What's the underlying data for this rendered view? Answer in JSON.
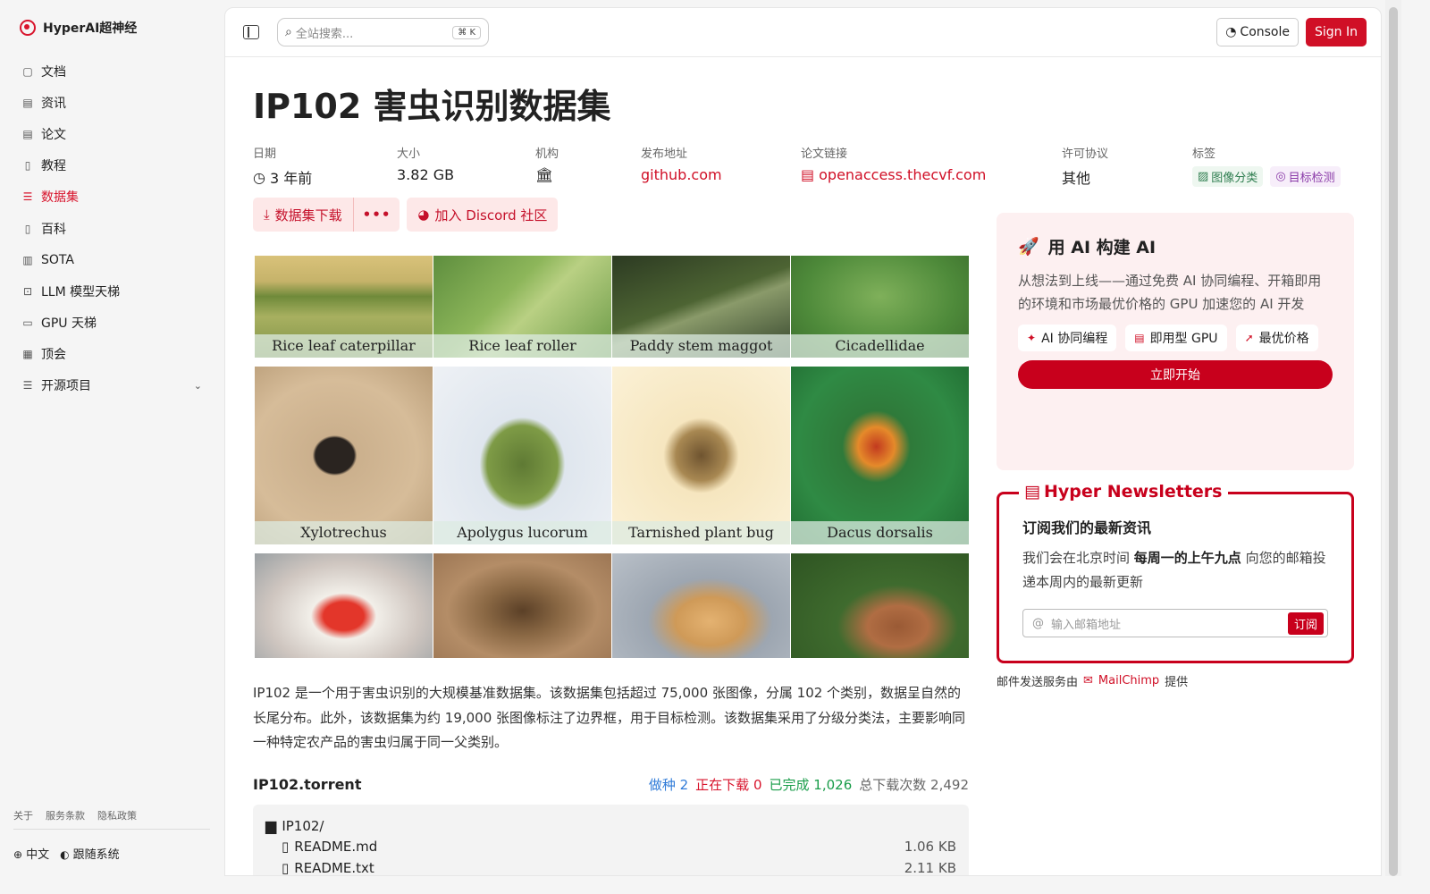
{
  "brand": {
    "name": "HyperAI超神经"
  },
  "sidebar": {
    "items": [
      {
        "label": "文档",
        "icon": "doc-icon"
      },
      {
        "label": "资讯",
        "icon": "news-icon"
      },
      {
        "label": "论文",
        "icon": "paper-icon"
      },
      {
        "label": "教程",
        "icon": "tutorial-icon"
      },
      {
        "label": "数据集",
        "icon": "database-icon",
        "active": true
      },
      {
        "label": "百科",
        "icon": "wiki-icon"
      },
      {
        "label": "SOTA",
        "icon": "chart-icon"
      },
      {
        "label": "LLM 模型天梯",
        "icon": "cpu-icon"
      },
      {
        "label": "GPU 天梯",
        "icon": "monitor-icon"
      },
      {
        "label": "顶会",
        "icon": "calendar-icon"
      },
      {
        "label": "开源项目",
        "icon": "list-icon"
      }
    ],
    "footer_links": [
      "关于",
      "服务条款",
      "隐私政策"
    ],
    "lang": "中文",
    "theme": "跟随系统"
  },
  "topbar": {
    "search_placeholder": "全站搜索...",
    "search_shortcut": "K",
    "console_label": "Console",
    "signin_label": "Sign In"
  },
  "dataset": {
    "title": "IP102 害虫识别数据集",
    "meta": {
      "date_label": "日期",
      "date_value": "3 年前",
      "size_label": "大小",
      "size_value": "3.82 GB",
      "org_label": "机构",
      "release_label": "发布地址",
      "release_value": "github.com",
      "paper_label": "论文链接",
      "paper_value": "openaccess.thecvf.com",
      "license_label": "许可协议",
      "license_value": "其他",
      "tags_label": "标签",
      "tag1": "图像分类",
      "tag2": "目标检测"
    },
    "download_label": "数据集下载",
    "more_label": "•••",
    "discord_label": "加入 Discord 社区",
    "images": [
      "Rice leaf caterpillar",
      "Rice leaf roller",
      "Paddy stem maggot",
      "Cicadellidae",
      "Xylotrechus",
      "Apolygus lucorum",
      "Tarnished plant bug",
      "Dacus dorsalis"
    ],
    "description": "IP102 是一个用于害虫识别的大规模基准数据集。该数据集包括超过 75,000 张图像，分属 102 个类别，数据呈自然的长尾分布。此外，该数据集为约 19,000 张图像标注了边界框，用于目标检测。该数据集采用了分级分类法，主要影响同一种特定农产品的害虫归属于同一父类别。",
    "torrent": {
      "name": "IP102.torrent",
      "seeding_label": "做种",
      "seeding_value": "2",
      "downloading_label": "正在下载",
      "downloading_value": "0",
      "completed_label": "已完成",
      "completed_value": "1,026",
      "total_label": "总下载次数",
      "total_value": "2,492"
    },
    "files": [
      {
        "name": "IP102/",
        "type": "folder",
        "size": ""
      },
      {
        "name": "README.md",
        "type": "file",
        "size": "1.06 KB"
      },
      {
        "name": "README.txt",
        "type": "file",
        "size": "2.11 KB"
      }
    ]
  },
  "promo": {
    "title": "用 AI 构建 AI",
    "text": "从想法到上线——通过免费 AI 协同编程、开箱即用的环境和市场最优价格的 GPU 加速您的 AI 开发",
    "chip1": "AI 协同编程",
    "chip2": "即用型 GPU",
    "chip3": "最优价格",
    "cta": "立即开始"
  },
  "newsletter": {
    "title": "Hyper Newsletters",
    "heading": "订阅我们的最新资讯",
    "text_pre": "我们会在北京时间",
    "text_bold": "每周一的上午九点",
    "text_post": "向您的邮箱投递本周内的最新更新",
    "email_placeholder": "输入邮箱地址",
    "subscribe_label": "订阅",
    "mail_note_pre": "邮件发送服务由",
    "mail_note_brand": "MailChimp",
    "mail_note_post": "提供"
  },
  "colors": {
    "accent": "#d00f26",
    "promo_bg": "#fdf0f1"
  }
}
